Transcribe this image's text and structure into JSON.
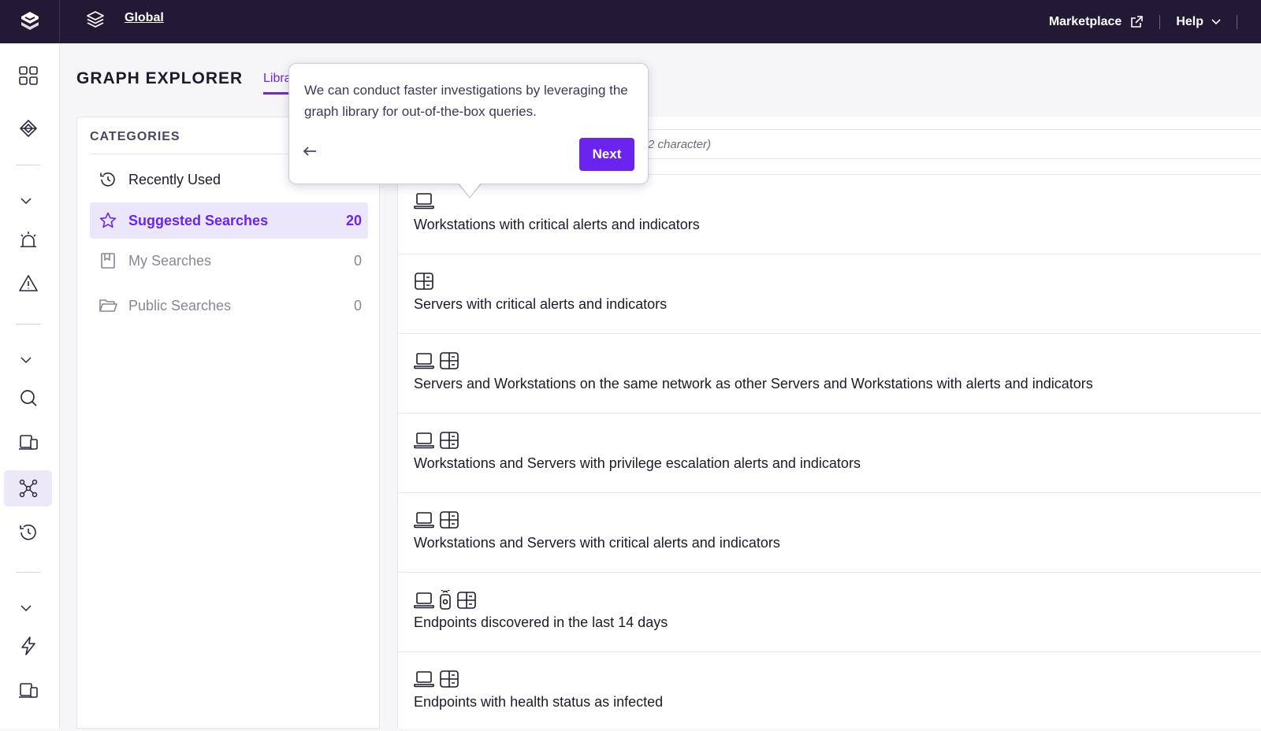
{
  "topbar": {
    "scope_label": "Global",
    "marketplace_label": "Marketplace",
    "help_label": "Help"
  },
  "page": {
    "title": "GRAPH EXPLORER",
    "tab_library": "Library"
  },
  "categories": {
    "title": "CATEGORIES",
    "items": [
      {
        "label": "Recently Used",
        "count": "",
        "icon": "history-icon"
      },
      {
        "label": "Suggested Searches",
        "count": "20",
        "icon": "star-icon"
      },
      {
        "label": "My Searches",
        "count": "0",
        "icon": "bookmark-icon"
      },
      {
        "label": "Public Searches",
        "count": "0",
        "icon": "folder-icon"
      }
    ]
  },
  "search": {
    "placeholder_visible": "2 character)"
  },
  "results": [
    {
      "label": "Workstations with critical alerts and indicators",
      "icons": [
        "laptop-icon"
      ]
    },
    {
      "label": "Servers with critical alerts and indicators",
      "icons": [
        "server-icon"
      ]
    },
    {
      "label": "Servers and Workstations on the same network as other Servers and Workstations with alerts and indicators",
      "icons": [
        "laptop-icon",
        "server-icon"
      ]
    },
    {
      "label": "Workstations and Servers with privilege escalation alerts and indicators",
      "icons": [
        "laptop-icon",
        "server-icon"
      ]
    },
    {
      "label": "Workstations and Servers with critical alerts and indicators",
      "icons": [
        "laptop-icon",
        "server-icon"
      ]
    },
    {
      "label": "Endpoints discovered in the last 14 days",
      "icons": [
        "laptop-icon",
        "mobile-icon",
        "server-icon"
      ]
    },
    {
      "label": "Endpoints with health status as infected",
      "icons": [
        "laptop-icon",
        "server-icon"
      ]
    }
  ],
  "tooltip": {
    "text": "We can conduct faster investigations by leveraging the graph library for out-of-the-box queries.",
    "next_label": "Next"
  },
  "colors": {
    "accent": "#6b24ef",
    "topbar": "#221a35"
  }
}
